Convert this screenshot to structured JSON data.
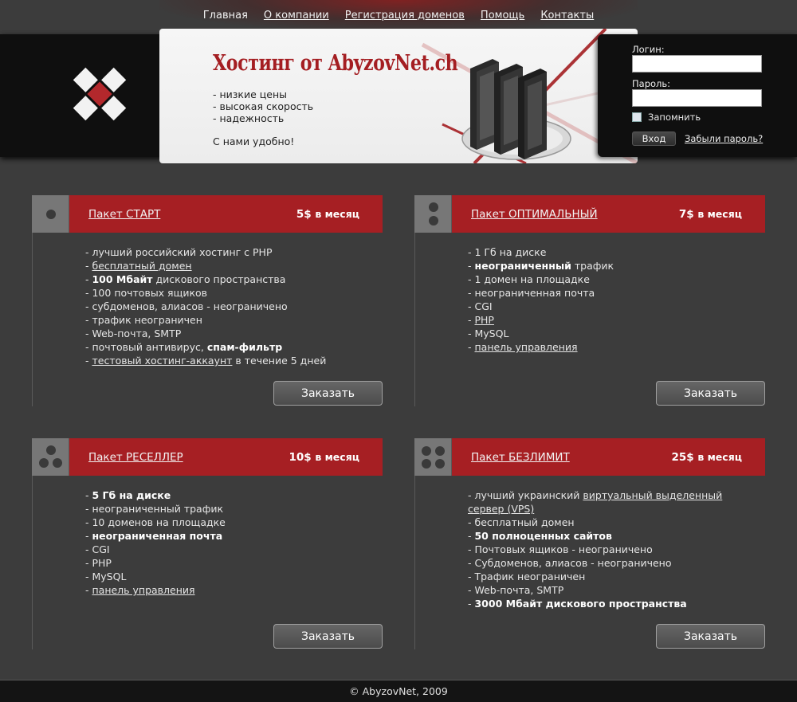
{
  "nav": {
    "items": [
      "Главная",
      "О компании",
      "Регистрация доменов",
      "Помощь",
      "Контакты"
    ]
  },
  "banner": {
    "title": "Хостинг от AbyzovNet.ch",
    "bullets": [
      "- низкие цены",
      "- высокая скорость",
      "- надежность"
    ],
    "tagline": "С нами удобно!"
  },
  "login": {
    "login_label": "Логин:",
    "login_value": "",
    "password_label": "Пароль:",
    "password_value": "",
    "remember_label": "Запомнить",
    "submit_label": "Вход",
    "forgot_label": "Забыли пароль?"
  },
  "packages": [
    {
      "name": "Пакет СТАРТ",
      "price": "5$",
      "period": "в месяц",
      "order_label": "Заказать",
      "features": [
        [
          {
            "t": "- лучший российский хостинг с PHP"
          }
        ],
        [
          {
            "t": "- "
          },
          {
            "t": "бесплатный домен",
            "link": true
          }
        ],
        [
          {
            "t": "- "
          },
          {
            "t": "100 Мбайт",
            "bold": true
          },
          {
            "t": " дискового пространства"
          }
        ],
        [
          {
            "t": "- 100 почтовых ящиков"
          }
        ],
        [
          {
            "t": "- субдоменов, алиасов - неограничено"
          }
        ],
        [
          {
            "t": "- трафик неограничен"
          }
        ],
        [
          {
            "t": "- Web-почта, SMTP"
          }
        ],
        [
          {
            "t": "- почтовый антивирус, "
          },
          {
            "t": "спам-фильтр",
            "bold": true
          }
        ],
        [
          {
            "t": "- "
          },
          {
            "t": "тестовый хостинг-аккаунт",
            "link": true
          },
          {
            "t": " в течение 5 дней"
          }
        ]
      ]
    },
    {
      "name": "Пакет ОПТИМАЛЬНЫЙ",
      "price": "7$",
      "period": "в месяц",
      "order_label": "Заказать",
      "features": [
        [
          {
            "t": "- 1 Гб на диске"
          }
        ],
        [
          {
            "t": "- "
          },
          {
            "t": "неограниченный",
            "bold": true
          },
          {
            "t": " трафик"
          }
        ],
        [
          {
            "t": "- 1 домен на площадке"
          }
        ],
        [
          {
            "t": "- неограниченная почта"
          }
        ],
        [
          {
            "t": "- CGI"
          }
        ],
        [
          {
            "t": "- "
          },
          {
            "t": "PHP",
            "link": true
          }
        ],
        [
          {
            "t": "- MySQL"
          }
        ],
        [
          {
            "t": "- "
          },
          {
            "t": "панель управления",
            "link": true
          }
        ]
      ]
    },
    {
      "name": "Пакет РЕСЕЛЛЕР",
      "price": "10$",
      "period": "в месяц",
      "order_label": "Заказать",
      "features": [
        [
          {
            "t": "- "
          },
          {
            "t": "5 Гб на диске",
            "bold": true
          }
        ],
        [
          {
            "t": "- неограниченный трафик"
          }
        ],
        [
          {
            "t": "- 10 доменов на площадке"
          }
        ],
        [
          {
            "t": "- "
          },
          {
            "t": "неограниченная почта",
            "bold": true
          }
        ],
        [
          {
            "t": "- CGI"
          }
        ],
        [
          {
            "t": "- PHP"
          }
        ],
        [
          {
            "t": "- MySQL"
          }
        ],
        [
          {
            "t": "- "
          },
          {
            "t": "панель управления",
            "link": true
          }
        ]
      ]
    },
    {
      "name": "Пакет БЕЗЛИМИТ",
      "price": "25$",
      "period": "в месяц",
      "order_label": "Заказать",
      "features": [
        [
          {
            "t": "- лучший украинский "
          },
          {
            "t": "виртуальный выделенный сервер (VPS)",
            "link": true
          }
        ],
        [
          {
            "t": "- бесплатный домен"
          }
        ],
        [
          {
            "t": "- "
          },
          {
            "t": "50 полноценных сайтов",
            "bold": true
          }
        ],
        [
          {
            "t": "- Почтовых ящиков - неограничено"
          }
        ],
        [
          {
            "t": "- Субдоменов, алиасов - неограничено"
          }
        ],
        [
          {
            "t": "- Трафик неограничен"
          }
        ],
        [
          {
            "t": "- Web-почта, SMTP"
          }
        ],
        [
          {
            "t": "- "
          },
          {
            "t": "3000 Мбайт дискового пространства",
            "bold": true
          }
        ]
      ]
    }
  ],
  "footer": {
    "copyright": "© AbyzovNet, 2009"
  },
  "colors": {
    "accent": "#a61f23",
    "background": "#3c3c3c",
    "dark_panel": "#0f0f0f"
  }
}
